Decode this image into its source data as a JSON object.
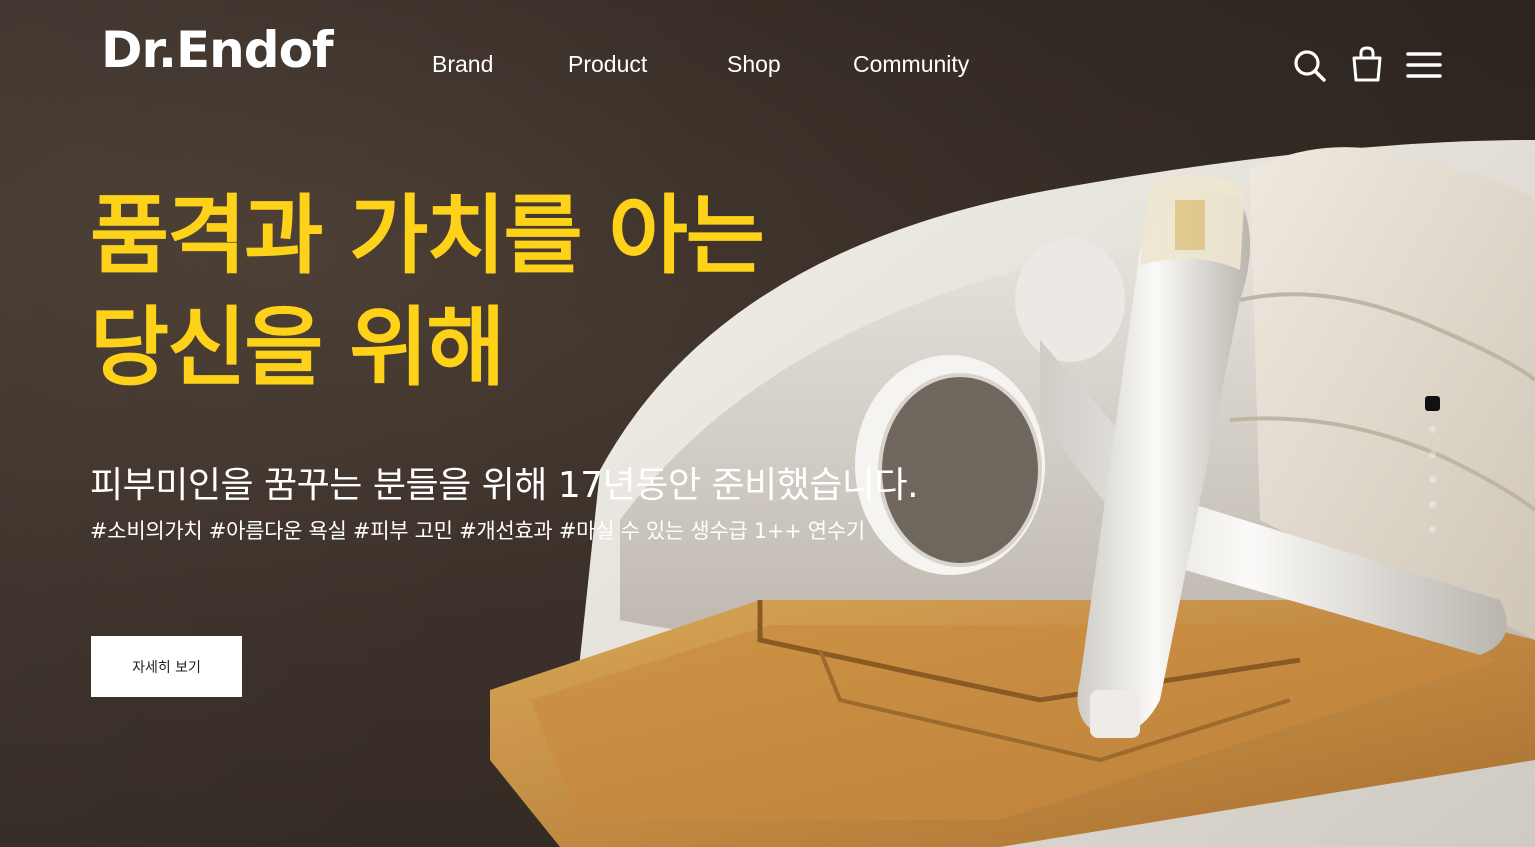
{
  "brand": {
    "logo": "Dr.Endof"
  },
  "nav": {
    "items": [
      {
        "label": "Brand"
      },
      {
        "label": "Product"
      },
      {
        "label": "Shop"
      },
      {
        "label": "Community"
      }
    ]
  },
  "header_icons": [
    "search-icon",
    "shopping-bag-icon",
    "menu-icon"
  ],
  "hero": {
    "headline_line1_strong": "품격과 가치",
    "headline_line1_rest": "를 아는",
    "headline_line2": "당신을 위해",
    "subline": "피부미인을 꿈꾸는 분들을 위해 17년동안 준비했습니다.",
    "tags": "#소비의가치 #아름다운 욕실 #피부 고민 #개선효과 #마실 수 있는 생수급 1++ 연수기",
    "cta_label": "자세히 보기"
  },
  "slider": {
    "total": 6,
    "active": 1
  },
  "colors": {
    "accent": "#ffd21a",
    "text": "#ffffff",
    "background": "#3b3029"
  }
}
